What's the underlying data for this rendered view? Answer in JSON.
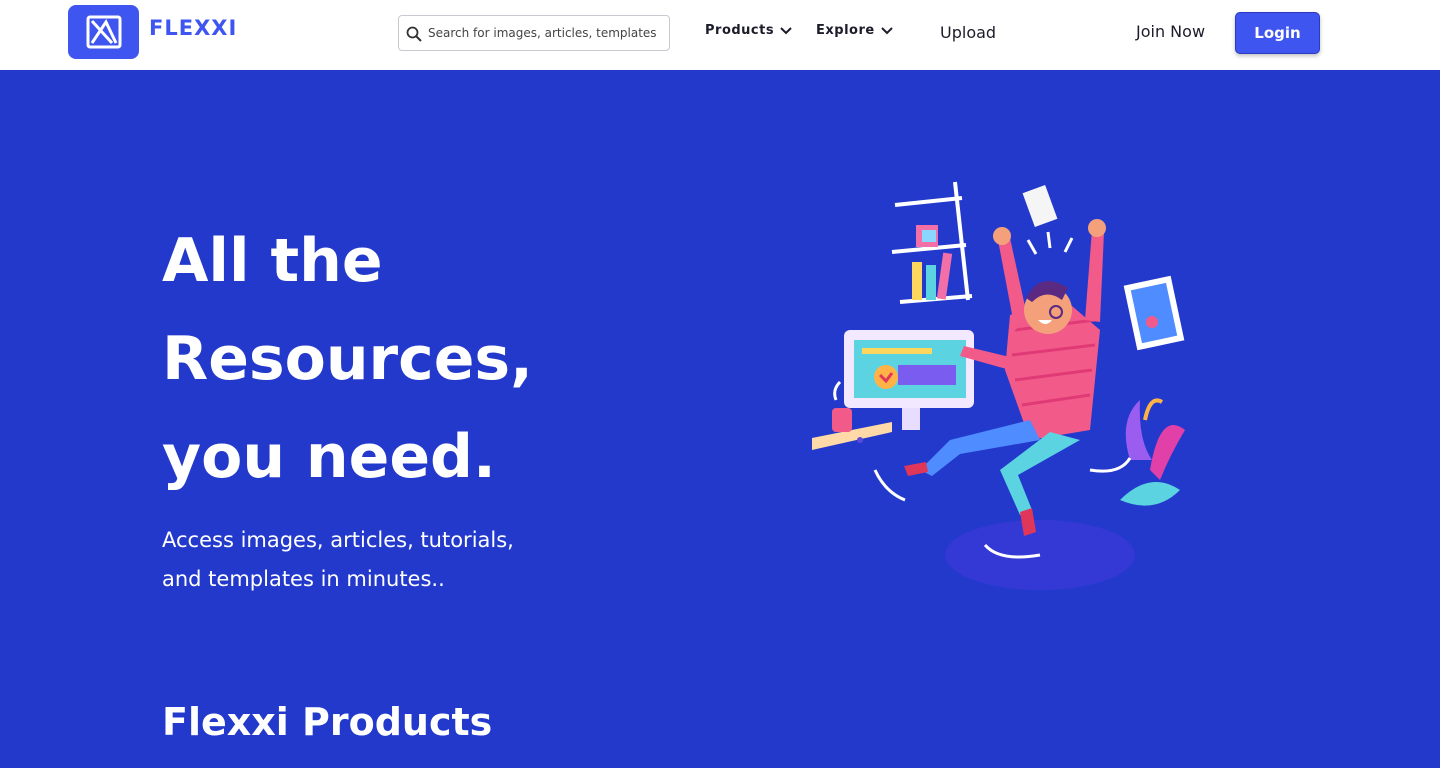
{
  "brand": {
    "name": "FLEXXI",
    "color": "#3f55f0",
    "logo_icon": "flexxi-logo-icon"
  },
  "search": {
    "placeholder": "Search for images, articles, templates",
    "value": "",
    "icon": "search-icon"
  },
  "nav": {
    "products": "Products",
    "explore": "Explore",
    "upload": "Upload",
    "dropdown_icon": "chevron-down-icon"
  },
  "auth": {
    "join_label": "Join Now",
    "login_label": "Login"
  },
  "hero": {
    "title_lines": [
      "All the",
      "Resources,",
      "you need."
    ],
    "subtitle_lines": [
      "Access images, articles, tutorials,",
      "and templates in minutes.."
    ],
    "background_color": "#2239cc",
    "illustration": "person-celebrating-at-computer-illustration"
  },
  "section": {
    "title": "Flexxi Products"
  }
}
